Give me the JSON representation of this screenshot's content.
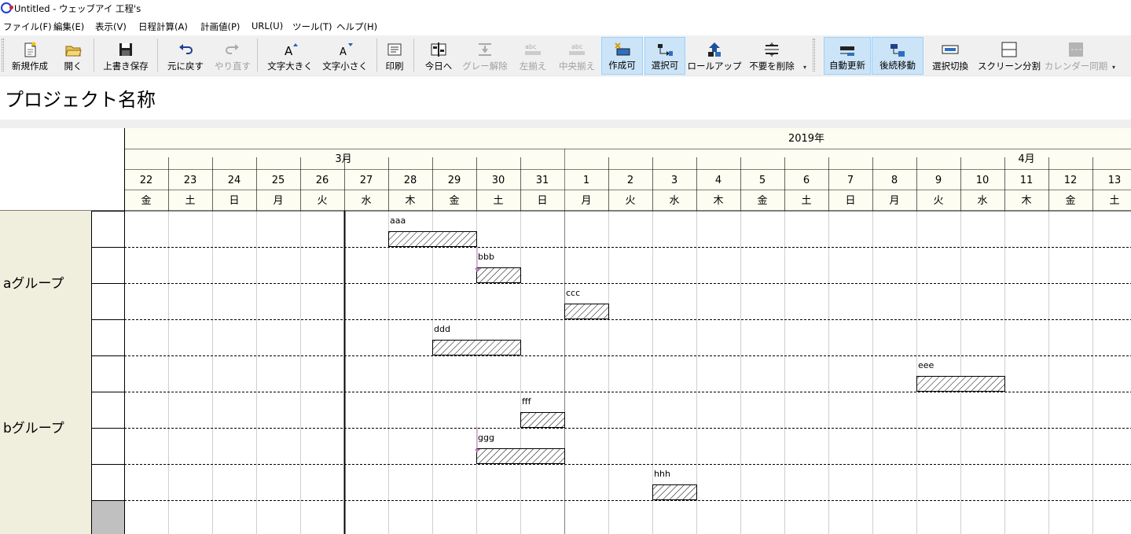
{
  "window": {
    "title": "Untitled - ウェッブアイ 工程's"
  },
  "menu": [
    "ファイル(F)",
    "編集(E)",
    "表示(V)",
    "日程計算(A)",
    "計画値(P)",
    "URL(U)",
    "ツール(T)",
    "ヘルプ(H)"
  ],
  "toolbar": {
    "new": "新規作成",
    "open": "開く",
    "save": "上書き保存",
    "undo": "元に戻す",
    "redo": "やり直す",
    "font_bigger": "文字大きく",
    "font_smaller": "文字小さく",
    "print": "印刷",
    "today": "今日へ",
    "gray_clear": "グレー解除",
    "align_left": "左揃え",
    "align_center": "中央揃え",
    "create_enabled": "作成可",
    "select_enabled": "選択可",
    "rollup": "ロールアップ",
    "remove_unneeded": "不要を削除",
    "auto_update": "自動更新",
    "move_successors": "後続移動",
    "select_toggle": "選択切換",
    "split_screen": "スクリーン分割",
    "calendar_sync": "カレンダー同期",
    "glyph_a": "A",
    "glyph_abc": "abc"
  },
  "project": {
    "title": "プロジェクト名称"
  },
  "gantt": {
    "year_label": "2019年",
    "months": [
      {
        "label": "3月"
      },
      {
        "label": "4月"
      }
    ],
    "days": [
      {
        "date": "22",
        "weekday": "金"
      },
      {
        "date": "23",
        "weekday": "土"
      },
      {
        "date": "24",
        "weekday": "日"
      },
      {
        "date": "25",
        "weekday": "月"
      },
      {
        "date": "26",
        "weekday": "火"
      },
      {
        "date": "27",
        "weekday": "水"
      },
      {
        "date": "28",
        "weekday": "木"
      },
      {
        "date": "29",
        "weekday": "金"
      },
      {
        "date": "30",
        "weekday": "土"
      },
      {
        "date": "31",
        "weekday": "日"
      },
      {
        "date": "1",
        "weekday": "月"
      },
      {
        "date": "2",
        "weekday": "火"
      },
      {
        "date": "3",
        "weekday": "水"
      },
      {
        "date": "4",
        "weekday": "木"
      },
      {
        "date": "5",
        "weekday": "金"
      },
      {
        "date": "6",
        "weekday": "土"
      },
      {
        "date": "7",
        "weekday": "日"
      },
      {
        "date": "8",
        "weekday": "月"
      },
      {
        "date": "9",
        "weekday": "火"
      },
      {
        "date": "10",
        "weekday": "水"
      },
      {
        "date": "11",
        "weekday": "木"
      },
      {
        "date": "12",
        "weekday": "金"
      },
      {
        "date": "13",
        "weekday": "土"
      }
    ],
    "today_index": 5,
    "groups": [
      {
        "name": "aグループ",
        "rows": 4
      },
      {
        "name": "bグループ",
        "rows": 4
      }
    ],
    "tasks": [
      {
        "name": "aaa",
        "row": 0,
        "start": 6,
        "days": 2
      },
      {
        "name": "bbb",
        "row": 1,
        "start": 8,
        "days": 1
      },
      {
        "name": "ccc",
        "row": 2,
        "start": 10,
        "days": 1
      },
      {
        "name": "ddd",
        "row": 3,
        "start": 7,
        "days": 2
      },
      {
        "name": "eee",
        "row": 4,
        "start": 18,
        "days": 2
      },
      {
        "name": "fff",
        "row": 5,
        "start": 9,
        "days": 1
      },
      {
        "name": "ggg",
        "row": 6,
        "start": 8,
        "days": 2
      },
      {
        "name": "hhh",
        "row": 7,
        "start": 12,
        "days": 1
      }
    ],
    "links": [
      {
        "from": 0,
        "to": 1
      },
      {
        "from": 5,
        "to": 6
      }
    ],
    "colors": {
      "header_bg": "#fdfdf1",
      "group_bg": "#f0eedc",
      "link": "#c080c0",
      "filler": "#c0c0c0"
    }
  }
}
